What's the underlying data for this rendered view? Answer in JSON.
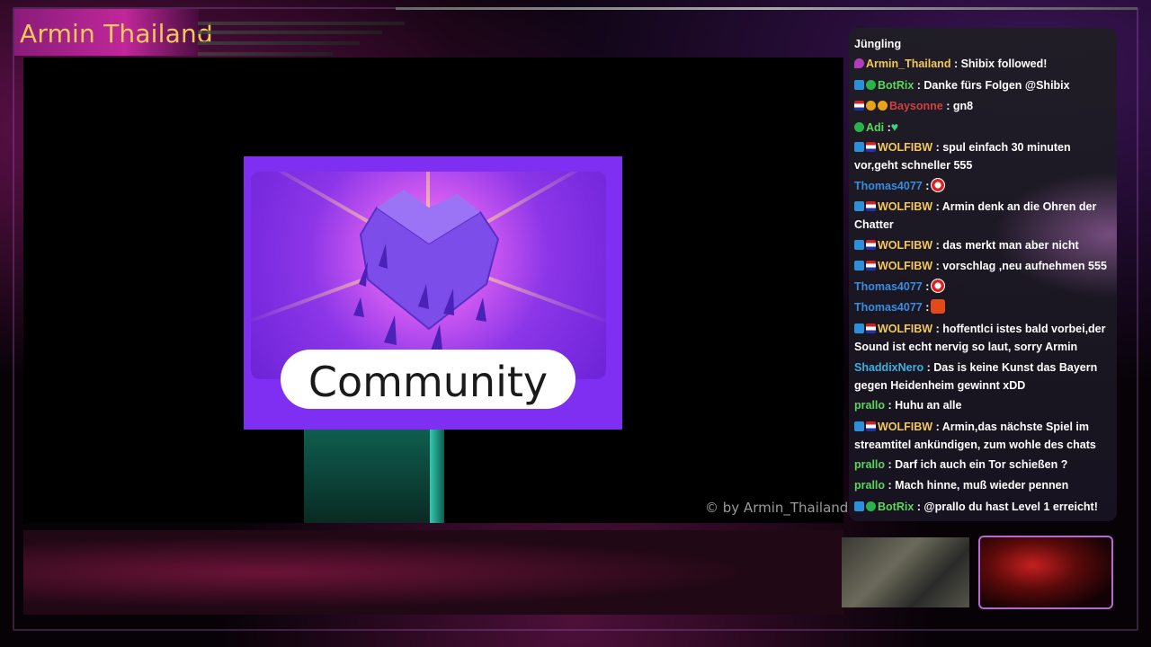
{
  "stream": {
    "title": "Armin Thailand",
    "copyright": "© by Armin_Thailand"
  },
  "scene": {
    "card_label": "Community"
  },
  "chat": {
    "messages": [
      {
        "user": "",
        "text": "Jüngling",
        "badges": []
      },
      {
        "user": "Armin_Thailand",
        "text": ": Shibix followed!",
        "badges": [
          "sub"
        ]
      },
      {
        "user": "BotRix",
        "text": ": Danke fürs Folgen @Shibix",
        "badges": [
          "prime",
          "check"
        ]
      },
      {
        "user": "Baysonne",
        "text": ": gn8",
        "badges": [
          "flag",
          "gold",
          "gold"
        ]
      },
      {
        "user": "Adi",
        "text": ":",
        "badges": [
          "check"
        ],
        "emote": "green-heart"
      },
      {
        "user": "WOLFIBW",
        "text": ": spul einfach 30 minuten vor,geht schneller 555",
        "badges": [
          "prime",
          "flag"
        ]
      },
      {
        "user": "Thomas4077",
        "text": ":",
        "badges": [],
        "emote": "fc-bayern"
      },
      {
        "user": "WOLFIBW",
        "text": ": Armin denk an die Ohren der Chatter",
        "badges": [
          "prime",
          "flag"
        ]
      },
      {
        "user": "WOLFIBW",
        "text": ": das merkt man aber nicht",
        "badges": [
          "prime",
          "flag"
        ]
      },
      {
        "user": "WOLFIBW",
        "text": ": vorschlag ,neu aufnehmen 555",
        "badges": [
          "prime",
          "flag"
        ]
      },
      {
        "user": "Thomas4077",
        "text": ":",
        "badges": [],
        "emote": "fc-bayern"
      },
      {
        "user": "Thomas4077",
        "text": ":",
        "badges": [],
        "emote": "hype"
      },
      {
        "user": "WOLFIBW",
        "text": ": hoffentlci istes bald vorbei,der Sound ist echt nervig so laut, sorry Armin",
        "badges": [
          "prime",
          "flag"
        ]
      },
      {
        "user": "ShaddixNero",
        "text": ": Das is keine Kunst das Bayern gegen Heidenheim gewinnt xDD",
        "badges": []
      },
      {
        "user": "prallo",
        "text": ": Huhu an alle",
        "badges": []
      },
      {
        "user": "WOLFIBW",
        "text": ": Armin,das nächste Spiel im streamtitel ankündigen, zum wohle des chats",
        "badges": [
          "prime",
          "flag"
        ]
      },
      {
        "user": "prallo",
        "text": ": Darf ich auch ein Tor schießen ?",
        "badges": []
      },
      {
        "user": "prallo",
        "text": ": Mach hinne, muß wieder pennen",
        "badges": []
      },
      {
        "user": "BotRix",
        "text": ": @prallo du hast Level 1 erreicht!",
        "badges": [
          "prime",
          "check"
        ]
      }
    ]
  },
  "colors": {
    "title": "#f3c75a",
    "card": "#7e2ff2",
    "user_gold": "#f3c75a",
    "user_green": "#5cd55c",
    "user_blue": "#3a8ce0"
  }
}
